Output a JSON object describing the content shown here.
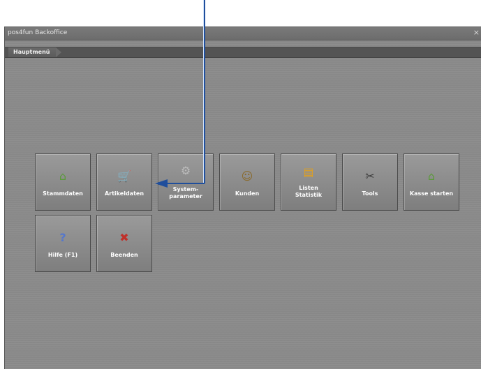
{
  "window": {
    "title": "pos4fun Backoffice",
    "close_glyph": "×"
  },
  "breadcrumb": {
    "label": "Hauptmenü"
  },
  "tiles": [
    {
      "label": "Stammdaten",
      "icon": "house-icon",
      "glyph": "⌂",
      "color": "#5b9a3a"
    },
    {
      "label": "Artikeldaten",
      "icon": "shopping-cart-icon",
      "glyph": "🛒",
      "color": "#4a4a4a"
    },
    {
      "label": "System-\nparameter",
      "icon": "gears-icon",
      "glyph": "⚙",
      "color": "#bcbcbc"
    },
    {
      "label": "Kunden",
      "icon": "customers-icon",
      "glyph": "☺",
      "color": "#7a5a2a"
    },
    {
      "label": "Listen\nStatistik",
      "icon": "bar-chart-icon",
      "glyph": "▤",
      "color": "#e0a020"
    },
    {
      "label": "Tools",
      "icon": "tools-icon",
      "glyph": "✂",
      "color": "#4a4a4a"
    },
    {
      "label": "Kasse starten",
      "icon": "house-icon",
      "glyph": "⌂",
      "color": "#5b9a3a"
    },
    {
      "label": "Hilfe (F1)",
      "icon": "help-icon",
      "glyph": "?",
      "color": "#5577cc"
    },
    {
      "label": "Beenden",
      "icon": "close-icon",
      "glyph": "✖",
      "color": "#c0302a"
    }
  ],
  "annotation_color": "#1f4e9c"
}
